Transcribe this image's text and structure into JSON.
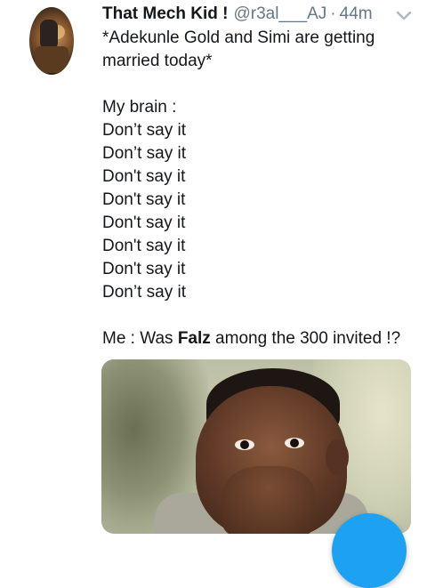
{
  "tweet": {
    "author_name": "That Mech Kid !",
    "handle": "@r3al___AJ",
    "separator": "·",
    "time": "44m",
    "lines": [
      "*Adekunle Gold and Simi are getting",
      "married today*",
      "",
      "My brain :",
      "Don’t say it",
      "Don’t say it",
      "Don't say it",
      "Don't say it",
      "Don't say it",
      "Don't say it",
      "Don't say it",
      "Don’t say it",
      ""
    ],
    "final_line": {
      "prefix": "Me : Was ",
      "bold": "Falz",
      "suffix": " among the 300  invited !?"
    }
  },
  "icons": {
    "menu": "chevron-down-icon",
    "compose": "compose-button"
  },
  "colors": {
    "text": "#14171a",
    "muted": "#657786",
    "accent": "#1da1f2"
  }
}
